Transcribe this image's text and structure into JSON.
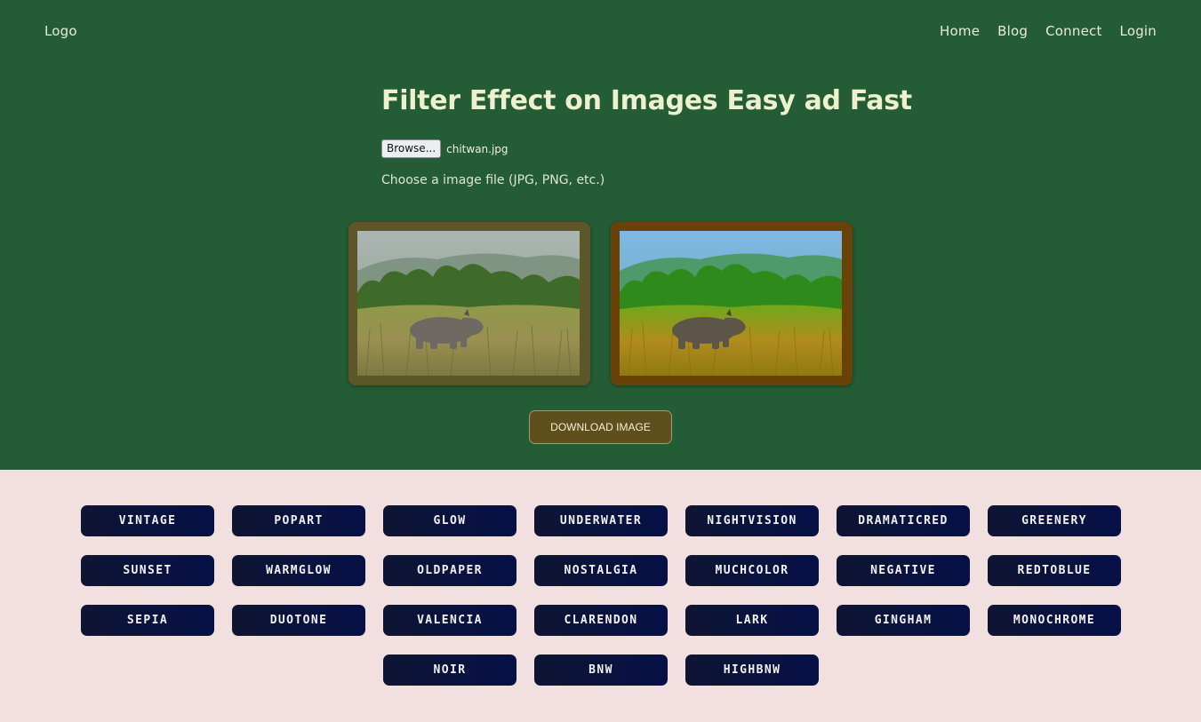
{
  "header": {
    "logo": "Logo",
    "nav": [
      "Home",
      "Blog",
      "Connect",
      "Login"
    ]
  },
  "main": {
    "title": "Filter Effect on Images Easy ad Fast",
    "browse_label": "Browse...",
    "file_name": "chitwan.jpg",
    "hint": "Choose a image file (JPG, PNG, etc.)",
    "download_label": "DOWNLOAD IMAGE"
  },
  "filters": [
    "VINTAGE",
    "POPART",
    "GLOW",
    "UNDERWATER",
    "NIGHTVISION",
    "DRAMATICRED",
    "GREENERY",
    "SUNSET",
    "WARMGLOW",
    "OLDPAPER",
    "NOSTALGIA",
    "MUCHCOLOR",
    "NEGATIVE",
    "REDTOBLUE",
    "SEPIA",
    "DUOTONE",
    "VALENCIA",
    "CLARENDON",
    "LARK",
    "GINGHAM",
    "MONOCHROME",
    "NOIR",
    "BNW",
    "HIGHBNW"
  ],
  "colors": {
    "hero_bg": "#245c35",
    "page_bg": "#f2e0e0",
    "button_bg": "#0a1240",
    "download_bg": "#5f4f1d"
  }
}
